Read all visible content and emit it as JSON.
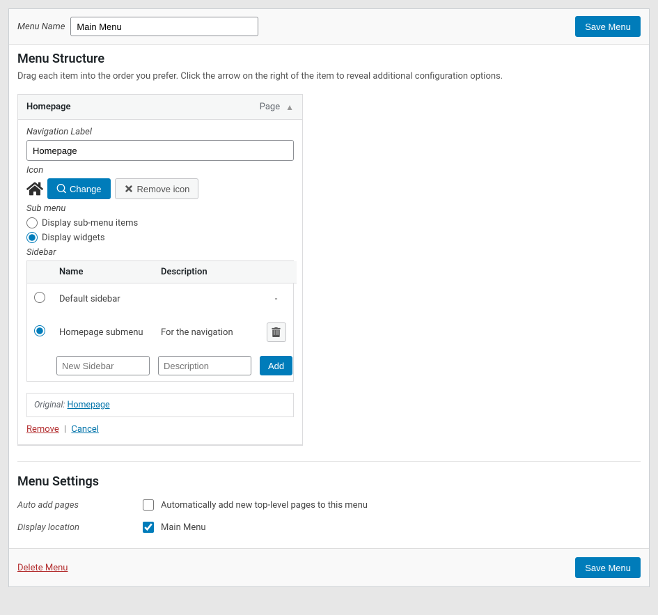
{
  "topbar": {
    "menu_name_label": "Menu Name",
    "menu_name_value": "Main Menu",
    "save_label": "Save Menu"
  },
  "structure": {
    "heading": "Menu Structure",
    "description": "Drag each item into the order you prefer. Click the arrow on the right of the item to reveal additional configuration options."
  },
  "item": {
    "title": "Homepage",
    "type": "Page",
    "nav_label_label": "Navigation Label",
    "nav_label_value": "Homepage",
    "icon_label": "Icon",
    "change_label": "Change",
    "remove_icon_label": "Remove icon",
    "submenu_label": "Sub menu",
    "submenu_option1": "Display sub-menu items",
    "submenu_option2": "Display widgets",
    "sidebar_label": "Sidebar",
    "sidebar_table": {
      "col_name": "Name",
      "col_desc": "Description",
      "rows": [
        {
          "name": "Default sidebar",
          "desc": "",
          "action": "-"
        },
        {
          "name": "Homepage submenu",
          "desc": "For the navigation",
          "action": "trash"
        }
      ],
      "new_name_placeholder": "New Sidebar",
      "new_desc_placeholder": "Description",
      "add_label": "Add"
    },
    "original_label": "Original:",
    "original_value": "Homepage",
    "remove_label": "Remove",
    "cancel_label": "Cancel"
  },
  "settings": {
    "heading": "Menu Settings",
    "auto_add_label": "Auto add pages",
    "auto_add_text": "Automatically add new top-level pages to this menu",
    "display_loc_label": "Display location",
    "display_loc_text": "Main Menu"
  },
  "bottom": {
    "delete_label": "Delete Menu",
    "save_label": "Save Menu"
  }
}
